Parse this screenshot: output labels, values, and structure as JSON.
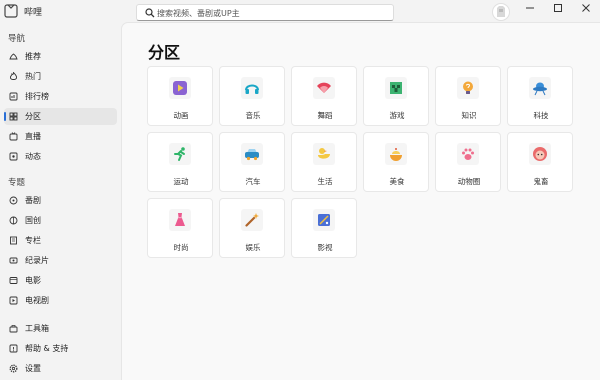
{
  "app": {
    "title": "哔哩",
    "logo_icon": "app-logo-icon"
  },
  "search": {
    "placeholder": "搜索视频、番剧或UP主",
    "value": "",
    "icon": "search-icon"
  },
  "window_controls": [
    "minimize-icon",
    "maximize-icon",
    "close-icon"
  ],
  "sidebar": {
    "sections": [
      {
        "label": "导航",
        "items": [
          {
            "label": "推荐",
            "icon": "recommend-icon"
          },
          {
            "label": "热门",
            "icon": "fire-icon"
          },
          {
            "label": "排行榜",
            "icon": "ranking-icon"
          },
          {
            "label": "分区",
            "icon": "category-icon",
            "active": true
          },
          {
            "label": "直播",
            "icon": "live-icon"
          },
          {
            "label": "动态",
            "icon": "dynamic-icon"
          }
        ]
      },
      {
        "label": "专题",
        "items": [
          {
            "label": "番剧",
            "icon": "anime-icon"
          },
          {
            "label": "国创",
            "icon": "guochuang-icon"
          },
          {
            "label": "专栏",
            "icon": "column-icon"
          },
          {
            "label": "纪录片",
            "icon": "documentary-icon"
          },
          {
            "label": "电影",
            "icon": "movie-icon"
          },
          {
            "label": "电视剧",
            "icon": "tv-icon"
          }
        ]
      }
    ],
    "bottom_items": [
      {
        "label": "工具箱",
        "icon": "toolbox-icon"
      },
      {
        "label": "帮助 & 支持",
        "icon": "help-icon"
      },
      {
        "label": "设置",
        "icon": "settings-icon"
      }
    ]
  },
  "main": {
    "title": "分区",
    "categories": [
      {
        "label": "动画",
        "icon": "animation-icon",
        "color": "#8a63d2"
      },
      {
        "label": "音乐",
        "icon": "headphones-icon",
        "color": "#1aa7c7"
      },
      {
        "label": "舞蹈",
        "icon": "dance-fan-icon",
        "color": "#e5435a"
      },
      {
        "label": "游戏",
        "icon": "game-creeper-icon",
        "color": "#3cb371"
      },
      {
        "label": "知识",
        "icon": "lightbulb-icon",
        "color": "#f3a83b"
      },
      {
        "label": "科技",
        "icon": "ufo-icon",
        "color": "#3a8fd9"
      },
      {
        "label": "运动",
        "icon": "running-icon",
        "color": "#2fb569"
      },
      {
        "label": "汽车",
        "icon": "car-icon",
        "color": "#2b8cc4"
      },
      {
        "label": "生活",
        "icon": "duck-icon",
        "color": "#f4c842"
      },
      {
        "label": "美食",
        "icon": "food-icon",
        "color": "#f0a030"
      },
      {
        "label": "动物圈",
        "icon": "paw-icon",
        "color": "#ef6f8e"
      },
      {
        "label": "鬼畜",
        "icon": "kichiku-face-icon",
        "color": "#ea6b6b"
      },
      {
        "label": "时尚",
        "icon": "dress-icon",
        "color": "#ec5a8f"
      },
      {
        "label": "娱乐",
        "icon": "magic-wand-icon",
        "color": "#f0a430"
      },
      {
        "label": "影视",
        "icon": "film-icon",
        "color": "#4a6fd6"
      }
    ]
  }
}
